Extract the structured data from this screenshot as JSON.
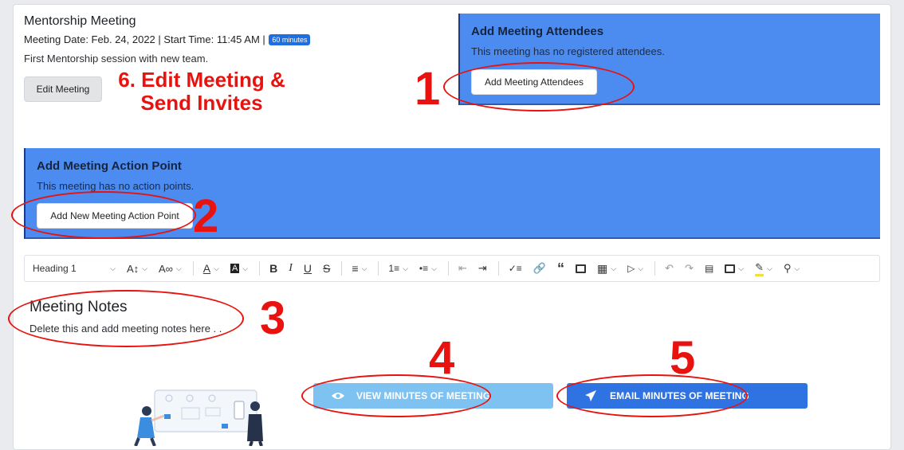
{
  "meeting": {
    "title": "Mentorship Meeting",
    "meta": "Meeting Date: Feb. 24, 2022 | Start Time: 11:45 AM |",
    "duration_badge": "60 minutes",
    "description": "First Mentorship session with new team.",
    "edit_button": "Edit Meeting"
  },
  "attendees": {
    "heading": "Add Meeting Attendees",
    "empty_text": "This meeting has no registered attendees.",
    "add_button": "Add Meeting Attendees"
  },
  "action_points": {
    "heading": "Add Meeting Action Point",
    "empty_text": "This meeting has no action points.",
    "add_button": "Add New Meeting Action Point"
  },
  "editor": {
    "heading_select": "Heading 1",
    "content_heading": "Meeting Notes",
    "content_text": "Delete this and add meeting notes here . ."
  },
  "actions": {
    "view_minutes": "VIEW MINUTES OF MEETING",
    "email_minutes": "EMAIL MINUTES OF MEETING"
  },
  "annotations": {
    "a1": "1",
    "a2": "2",
    "a3": "3",
    "a4": "4",
    "a5": "5",
    "a6_line1": "6. Edit Meeting &",
    "a6_line2": "Send Invites"
  },
  "colors": {
    "panel_blue": "#4c8cf0",
    "annotation_red": "#e8120e",
    "view_button": "#7ec2f2",
    "email_button": "#2f72e2",
    "badge_blue": "#1f6fe0"
  }
}
